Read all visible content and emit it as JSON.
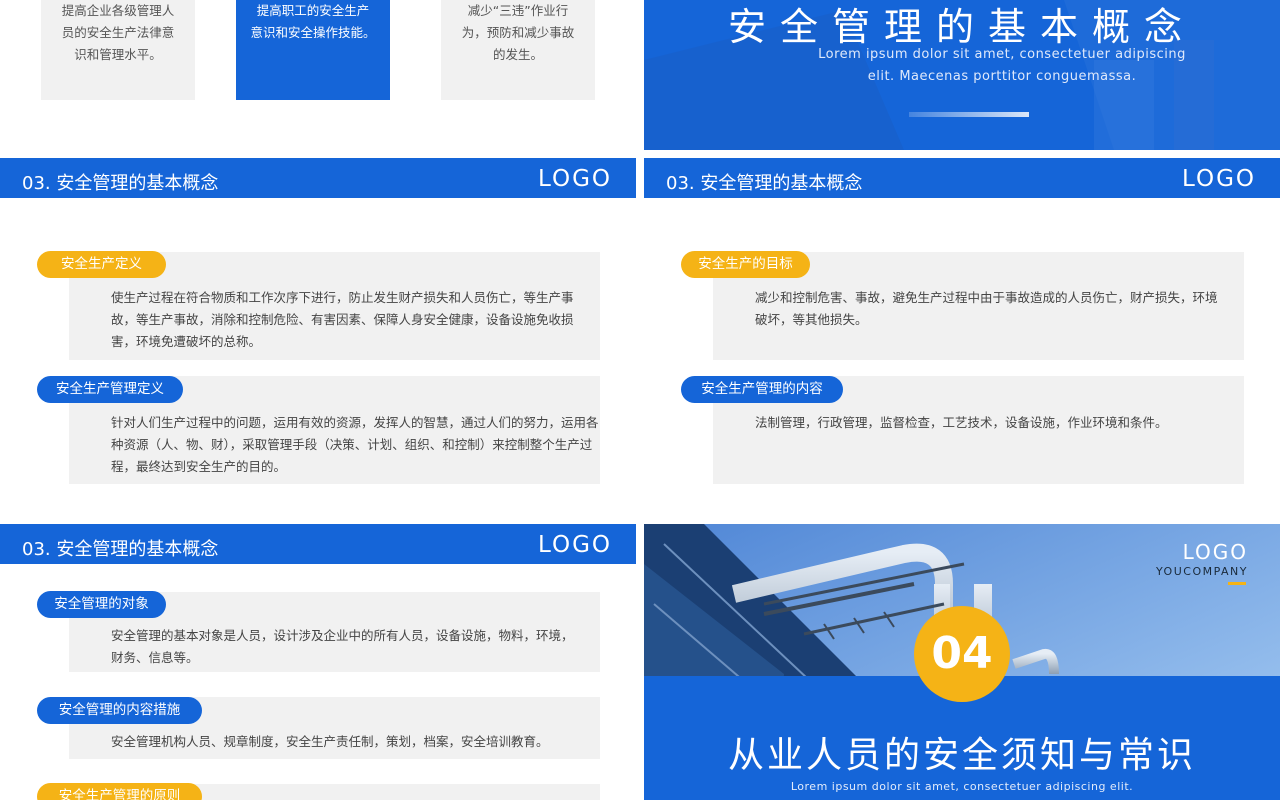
{
  "slide1": {
    "cards": [
      {
        "lines": [
          "提高企业各级管理人",
          "员的安全生产法律意",
          "识和管理水平。"
        ]
      },
      {
        "lines": [
          "提高职工的安全生产",
          "意识和安全操作技能。"
        ]
      },
      {
        "lines": [
          "减少“三违”作业行",
          "为，预防和减少事故",
          "的发生。"
        ]
      }
    ]
  },
  "slide2": {
    "title": "安全管理的基本概念",
    "subtitle_line1": "Lorem ipsum dolor sit amet, consectetuer adipiscing",
    "subtitle_line2": "elit. Maecenas porttitor conguemassa."
  },
  "header": {
    "section_title": "03. 安全管理的基本概念",
    "logo": "LOGO"
  },
  "slide3": {
    "items": [
      {
        "label": "安全生产定义",
        "lines": [
          "使生产过程在符合物质和工作次序下进行，防止发生财产损失和人员伤亡，等生产事",
          "故，等生产事故，消除和控制危险、有害因素、保障人身安全健康，设备设施免收损",
          "害，环境免遭破坏的总称。"
        ]
      },
      {
        "label": "安全生产管理定义",
        "lines": [
          "针对人们生产过程中的问题，运用有效的资源，发挥人的智慧，通过人们的努力，运用各",
          "种资源（人、物、财），采取管理手段（决策、计划、组织、和控制）来控制整个生产过",
          "程，最终达到安全生产的目的。"
        ]
      }
    ]
  },
  "slide4": {
    "items": [
      {
        "label": "安全生产的目标",
        "lines": [
          "减少和控制危害、事故，避免生产过程中由于事故造成的人员伤亡，财产损失，环境",
          "破坏，等其他损失。"
        ]
      },
      {
        "label": "安全生产管理的内容",
        "lines": [
          "法制管理，行政管理，监督检查，工艺技术，设备设施，作业环境和条件。"
        ]
      }
    ]
  },
  "slide5": {
    "items": [
      {
        "label": "安全管理的对象",
        "lines": [
          "安全管理的基本对象是人员，设计涉及企业中的所有人员，设备设施，物料，环境，",
          "财务、信息等。"
        ]
      },
      {
        "label": "安全管理的内容措施",
        "lines": [
          "安全管理机构人员、规章制度，安全生产责任制，策划，档案，安全培训教育。"
        ]
      },
      {
        "label": "安全生产管理的原则",
        "lines": []
      }
    ]
  },
  "slide6": {
    "logo": "LOGO",
    "company": "YOUCOMPANY",
    "number": "04",
    "title": "从业人员的安全须知与常识",
    "subtitle": "Lorem ipsum dolor sit amet, consectetuer adipiscing elit."
  },
  "colors": {
    "primary_blue": "#1565d8",
    "accent_yellow": "#f5b316",
    "box_gray": "#f1f1f1"
  }
}
